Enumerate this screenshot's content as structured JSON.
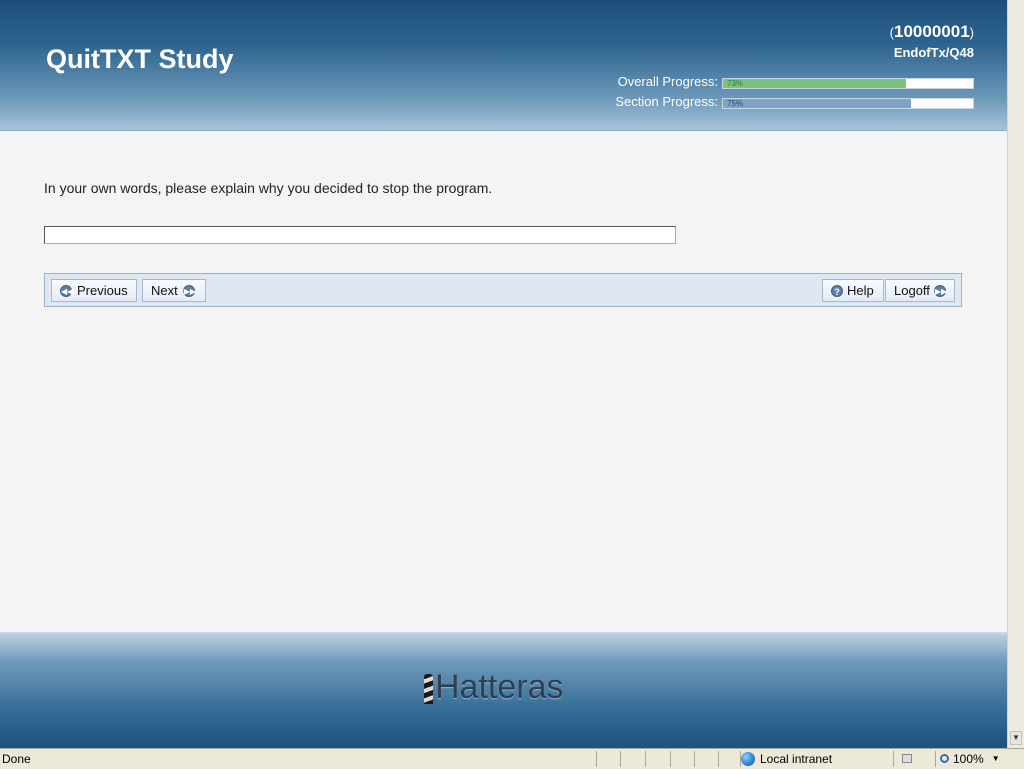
{
  "header": {
    "app_title": "QuitTXT Study",
    "participant_id": "10000001",
    "paren_open": "(",
    "paren_close": ")",
    "location": "EndofTx/Q48",
    "overall_progress": {
      "label": "Overall Progress:",
      "percent_text": "73%",
      "value": 0.73
    },
    "section_progress": {
      "label": "Section Progress:",
      "percent_text": "75%",
      "value": 0.75
    }
  },
  "main": {
    "question": "In your own words, please explain why you decided to stop the program.",
    "answer_value": ""
  },
  "nav": {
    "previous_label": "Previous",
    "next_label": "Next",
    "help_label": "Help",
    "logoff_label": "Logoff"
  },
  "footer": {
    "logo_text": "Hatteras"
  },
  "statusbar": {
    "status_text": "Done",
    "zone_label": "Local intranet",
    "zoom_label": "100%"
  },
  "colors": {
    "header_dark": "#1b4f7a",
    "overall_fill": "#7ac27d",
    "section_fill": "#7fa3c4",
    "navbar_bg": "#dfe7f3"
  },
  "icons": [
    "prev-icon",
    "next-icon",
    "help-icon",
    "logoff-icon",
    "globe-icon",
    "lock-icon",
    "zoom-icon"
  ]
}
